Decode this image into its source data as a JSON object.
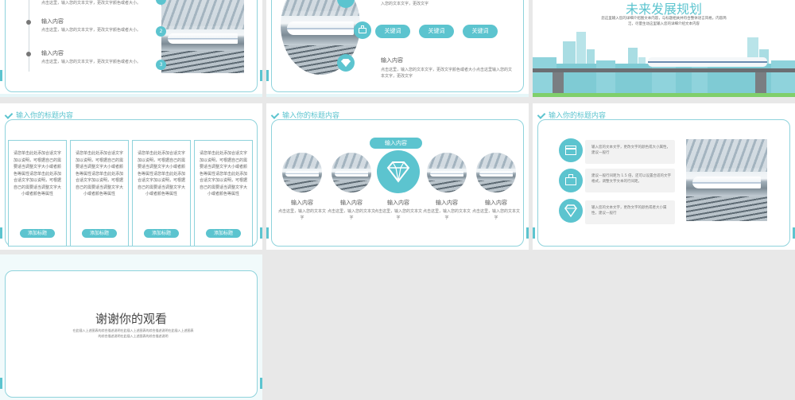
{
  "slide1": {
    "items": [
      {
        "title": "",
        "desc": "点击这里，输入您的文本文字，更改文字颜色或者大小。"
      },
      {
        "title": "输入内容",
        "desc": "点击这里，输入您的文本文字，更改文字颜色或者大小。"
      },
      {
        "title": "输入内容",
        "desc": "点击这里，输入您的文本文字，更改文字颜色或者大小。"
      }
    ],
    "numbers": [
      "2",
      "3"
    ]
  },
  "slide2": {
    "top_desc": "入您的文本文字，更改文字",
    "keywords": [
      "关键词",
      "关键词",
      "关键词"
    ],
    "heading": "输入内容",
    "desc": "点击这里，输入您的文本文字，更改文字颜色或者大小点击这里输入您的文本文字，更改文字"
  },
  "slide3": {
    "title": "未来发展规划",
    "desc": "您这里输入您的详细介绍图文本内容，与标题相关并符合整体语言风格，内容简洁，尽量生动这里输入您的详细介绍文本内容"
  },
  "slide4": {
    "title": "输入你的标题内容",
    "cards": [
      {
        "text": "请您单击此处添加合适文字加以说明，可根据自己的需要适当调整文字大小或者颜色等属性请您单击此处添加合适文字加以说明，可根据自己的需要适当调整文字大小或者颜色等属性",
        "tag": "添加标题"
      },
      {
        "text": "请您单击此处添加合适文字加以说明，可根据自己的需要适当调整文字大小或者颜色等属性请您单击此处添加合适文字加以说明，可根据自己的需要适当调整文字大小或者颜色等属性",
        "tag": "添加标题"
      },
      {
        "text": "请您单击此处添加合适文字加以说明，可根据自己的需要适当调整文字大小或者颜色等属性请您单击此处添加合适文字加以说明，可根据自己的需要适当调整文字大小或者颜色等属性",
        "tag": "添加标题"
      },
      {
        "text": "请您单击此处添加合适文字加以说明，可根据自己的需要适当调整文字大小或者颜色等属性请您单击此处添加合适文字加以说明，可根据自己的需要适当调整文字大小或者颜色等属性",
        "tag": "添加标题"
      }
    ]
  },
  "slide5": {
    "title": "输入你的标题内容",
    "banner": "输入内容",
    "items": [
      {
        "title": "输入内容",
        "desc": "点击这里，输入您的文本文字"
      },
      {
        "title": "输入内容",
        "desc": "点击这里，输入您的文本文字"
      },
      {
        "title": "输入内容",
        "desc": "点击这里，输入您的文本文字"
      },
      {
        "title": "输入内容",
        "desc": "点击这里，输入您的文本文字"
      },
      {
        "title": "输入内容",
        "desc": "点击这里，输入您的文本文字"
      }
    ]
  },
  "slide6": {
    "title": "输入你的标题内容",
    "rows": [
      {
        "icon": "calendar-icon",
        "text": "输入您的文本文字，更改文字的颜色或大小属性，建议一般行"
      },
      {
        "icon": "toolbox-icon",
        "text": "建议一般行间距为 1.5 倍，还可以设置合适的文字格式，调整文字文本的行间距。"
      },
      {
        "icon": "diamond-icon",
        "text": "输入您的文本文字，更改文字的颜色或者大小属性，建议一般行"
      }
    ]
  },
  "slide7": {
    "title": "谢谢你的观看",
    "desc": "在此插入上述图表的综合描述说明在此插入上述图表的综合描述说明在此插入上述图表的综合描述说明在此插入上述图表的综合描述说明"
  },
  "colors": {
    "accent": "#5cc4cf",
    "frame": "#8fd3dc",
    "background": "#e8e8e8"
  }
}
